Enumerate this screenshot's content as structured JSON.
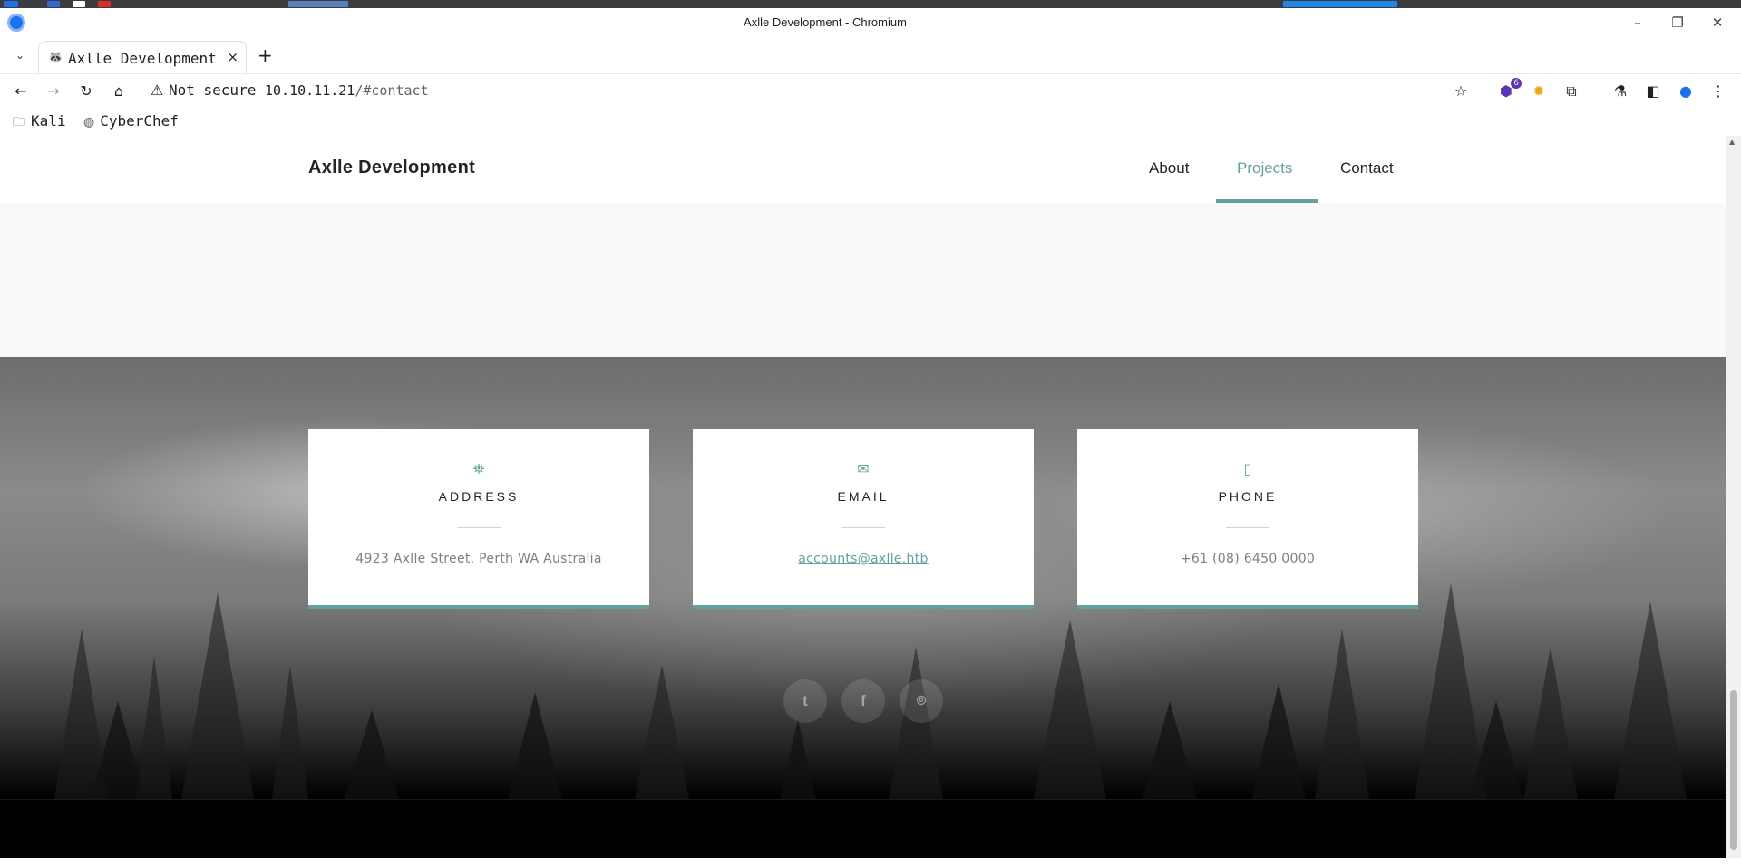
{
  "window": {
    "title": "Axlle Development - Chromium"
  },
  "tab": {
    "label": "Axlle Development",
    "close": "×",
    "new_tab": "+"
  },
  "toolbar": {
    "warning_icon": "⚠",
    "security_label": "Not secure",
    "host": "10.10.11.21",
    "path": "/#contact",
    "extension_badge": "6"
  },
  "bookmarks": [
    {
      "label": "Kali",
      "icon": "folder-icon"
    },
    {
      "label": "CyberChef",
      "icon": "cyberchef-icon"
    }
  ],
  "site": {
    "brand": "Axlle Development",
    "nav": [
      {
        "label": "About",
        "active": false
      },
      {
        "label": "Projects",
        "active": true
      },
      {
        "label": "Contact",
        "active": false
      }
    ],
    "accent": "#64a19d"
  },
  "contact": {
    "cards": [
      {
        "icon": "map-icon",
        "title": "ADDRESS",
        "value": "4923 Axlle Street, Perth WA Australia"
      },
      {
        "icon": "envelope-icon",
        "title": "EMAIL",
        "value": "accounts@axlle.htb"
      },
      {
        "icon": "mobile-icon",
        "title": "PHONE",
        "value": "+61 (08) 6450 0000"
      }
    ],
    "social": [
      {
        "icon": "twitter-icon",
        "glyph": "t"
      },
      {
        "icon": "facebook-icon",
        "glyph": "f"
      },
      {
        "icon": "github-icon",
        "glyph": "⌾"
      }
    ]
  }
}
